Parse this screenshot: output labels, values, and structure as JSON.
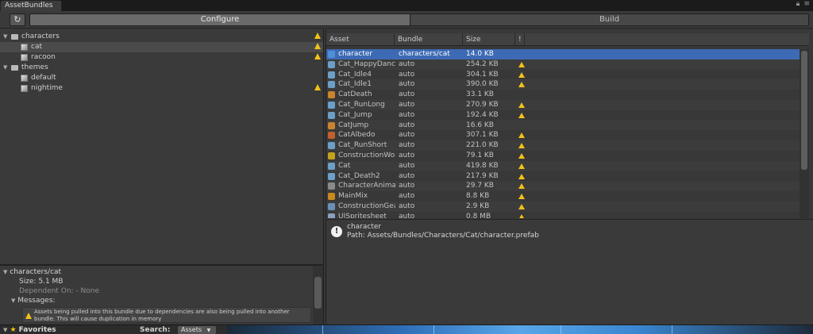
{
  "window": {
    "tab_title": "AssetBundles"
  },
  "toolbar": {
    "refresh_icon": "refresh-icon",
    "tabs": [
      {
        "label": "Configure",
        "active": true
      },
      {
        "label": "Build",
        "active": false
      }
    ]
  },
  "tree": {
    "items": [
      {
        "label": "characters",
        "kind": "folder",
        "warning": true,
        "expanded": true,
        "selected": false
      },
      {
        "label": "cat",
        "kind": "bundle",
        "warning": true,
        "selected": true
      },
      {
        "label": "racoon",
        "kind": "bundle",
        "warning": true,
        "selected": false
      },
      {
        "label": "themes",
        "kind": "folder",
        "warning": false,
        "expanded": true,
        "selected": false
      },
      {
        "label": "default",
        "kind": "bundle",
        "warning": false,
        "selected": false
      },
      {
        "label": "nightime",
        "kind": "bundle",
        "warning": true,
        "selected": false
      }
    ]
  },
  "info": {
    "bundle_name": "characters/cat",
    "size": "Size: 5.1 MB",
    "dependent_on": "Dependent On: - None",
    "messages_label": "Messages:",
    "message": "Assets being pulled into this bundle due to dependencies are also being pulled into another bundle.  This will cause duplication in memory"
  },
  "table": {
    "columns": [
      "Asset",
      "Bundle",
      "Size",
      "!"
    ],
    "rows": [
      {
        "asset": "character",
        "bundle": "characters/cat",
        "size": "14.0 KB",
        "warning": false,
        "icon": "prefab-icon",
        "color": "#4f8fd6"
      },
      {
        "asset": "Cat_HappyDance",
        "bundle": "auto",
        "size": "254.2 KB",
        "warning": true,
        "icon": "animation-icon",
        "color": "#6c9fc8"
      },
      {
        "asset": "Cat_Idle4",
        "bundle": "auto",
        "size": "304.1 KB",
        "warning": true,
        "icon": "animation-icon",
        "color": "#6c9fc8"
      },
      {
        "asset": "Cat_Idle1",
        "bundle": "auto",
        "size": "390.0 KB",
        "warning": true,
        "icon": "animation-icon",
        "color": "#6c9fc8"
      },
      {
        "asset": "CatDeath",
        "bundle": "auto",
        "size": "33.1 KB",
        "warning": false,
        "icon": "audio-icon",
        "color": "#c8842e"
      },
      {
        "asset": "Cat_RunLong",
        "bundle": "auto",
        "size": "270.9 KB",
        "warning": true,
        "icon": "animation-icon",
        "color": "#6c9fc8"
      },
      {
        "asset": "Cat_Jump",
        "bundle": "auto",
        "size": "192.4 KB",
        "warning": true,
        "icon": "animation-icon",
        "color": "#6c9fc8"
      },
      {
        "asset": "CatJump",
        "bundle": "auto",
        "size": "16.6 KB",
        "warning": false,
        "icon": "audio-icon",
        "color": "#c8842e"
      },
      {
        "asset": "CatAlbedo",
        "bundle": "auto",
        "size": "307.1 KB",
        "warning": true,
        "icon": "texture-icon",
        "color": "#c0602a"
      },
      {
        "asset": "Cat_RunShort",
        "bundle": "auto",
        "size": "221.0 KB",
        "warning": true,
        "icon": "animation-icon",
        "color": "#6c9fc8"
      },
      {
        "asset": "ConstructionWor",
        "bundle": "auto",
        "size": "79.1 KB",
        "warning": true,
        "icon": "texture-icon",
        "color": "#c4a21c"
      },
      {
        "asset": "Cat",
        "bundle": "auto",
        "size": "419.8 KB",
        "warning": true,
        "icon": "animation-icon",
        "color": "#6c9fc8"
      },
      {
        "asset": "Cat_Death2",
        "bundle": "auto",
        "size": "217.9 KB",
        "warning": true,
        "icon": "animation-icon",
        "color": "#6c9fc8"
      },
      {
        "asset": "CharacterAnima",
        "bundle": "auto",
        "size": "29.7 KB",
        "warning": true,
        "icon": "animator-icon",
        "color": "#8a8a8a"
      },
      {
        "asset": "MainMix",
        "bundle": "auto",
        "size": "8.8 KB",
        "warning": true,
        "icon": "mixer-icon",
        "color": "#c88a1c"
      },
      {
        "asset": "ConstructionGea",
        "bundle": "auto",
        "size": "2.9 KB",
        "warning": true,
        "icon": "material-icon",
        "color": "#6a8fb8"
      },
      {
        "asset": "UISpritesheet",
        "bundle": "auto",
        "size": "0.8 MB",
        "warning": true,
        "icon": "sprite-icon",
        "color": "#8aa0c0"
      }
    ]
  },
  "detail": {
    "name": "character",
    "path": "Path: Assets/Bundles/Characters/Cat/character.prefab"
  },
  "bottom": {
    "favorites": "Favorites",
    "search_label": "Search:",
    "search_scope": "Assets"
  }
}
